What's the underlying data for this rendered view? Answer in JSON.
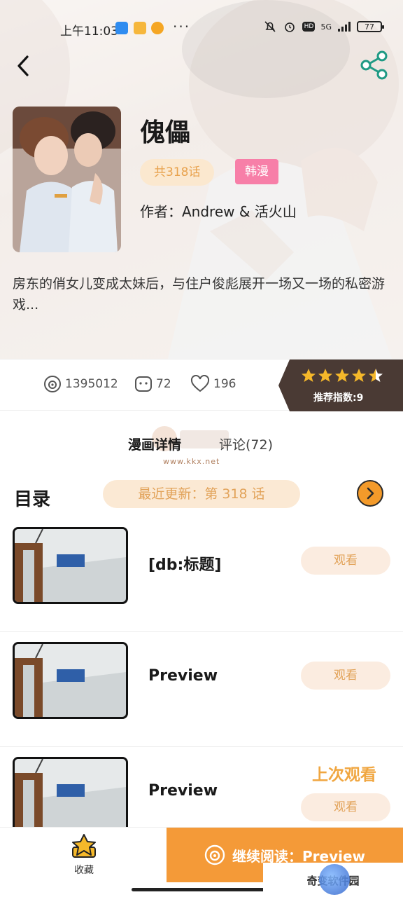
{
  "status_bar": {
    "time": "上午11:03",
    "more": "···",
    "network": "5G",
    "battery": "77"
  },
  "comic": {
    "title": "傀儡",
    "episode_count": "共318话",
    "genre": "韩漫",
    "author": "作者：Andrew & 活火山",
    "description": "房东的俏女儿变成太妹后，与住户俊彪展开一场又一场的私密游戏..."
  },
  "stats": {
    "views": "1395012",
    "comments": "72",
    "likes": "196",
    "rating_label": "推荐指数:9",
    "stars": 4.5
  },
  "tabs": [
    {
      "label": "漫画详情",
      "active": true
    },
    {
      "label": "评论(72)",
      "active": false
    }
  ],
  "watermark": "www.kkx.net",
  "catalog": {
    "title": "目录",
    "latest": "最近更新：第 318 话",
    "chapters": [
      {
        "title": "[db:标题]",
        "action": "观看",
        "last_read": ""
      },
      {
        "title": "Preview",
        "action": "观看",
        "last_read": ""
      },
      {
        "title": "Preview",
        "action": "观看",
        "last_read": "上次观看"
      }
    ]
  },
  "bottom_bar": {
    "favorite_label": "收藏",
    "continue_label": "继续阅读：Preview",
    "site_label": "奇变软件园"
  },
  "colors": {
    "accent": "#f49a38",
    "pill_bg": "#fbe9d4",
    "pill_text": "#e2a35a",
    "genre": "#f77fa8",
    "rating_bg": "#4a3a34",
    "star": "#f5b82a"
  }
}
